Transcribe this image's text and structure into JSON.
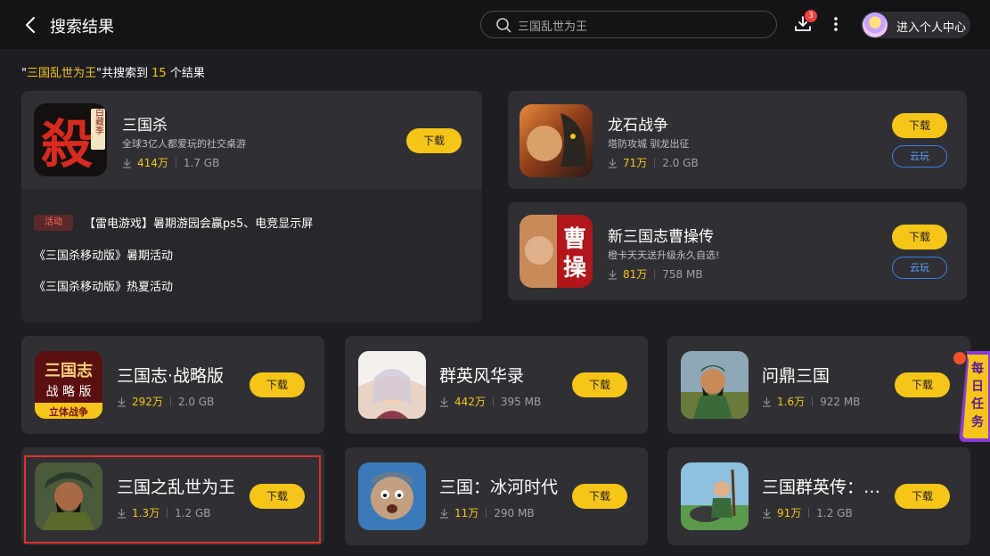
{
  "header": {
    "title": "搜索结果",
    "search_value": "三国乱世为王",
    "download_badge": "3",
    "user_center_label": "进入个人中心"
  },
  "summary": {
    "quote_open": "\"",
    "keyword": "三国乱世为王",
    "quote_close": "\"",
    "text_mid": "共搜索到",
    "count": "15",
    "text_end": "个结果"
  },
  "featured": {
    "name": "三国杀",
    "icon_text": "殺",
    "icon_badge": "白藏季",
    "desc": "全球3亿人都爱玩的社交桌游",
    "downloads": "414万",
    "size": "1.7 GB",
    "download_label": "下载",
    "events": [
      {
        "tag": "活动",
        "title": "【雷电游戏】暑期游园会赢ps5、电竞显示屏"
      },
      {
        "tag": "",
        "title": "《三国杀移动版》暑期活动"
      },
      {
        "tag": "",
        "title": "《三国杀移动版》热夏活动"
      }
    ]
  },
  "side_apps": [
    {
      "name": "龙石战争",
      "desc": "塔防攻城 驯龙出征",
      "downloads": "71万",
      "size": "2.0 GB",
      "download_label": "下载",
      "cloud_label": "云玩"
    },
    {
      "name": "新三国志曹操传",
      "desc": "橙卡天天送升级永久自选!",
      "downloads": "81万",
      "size": "758 MB",
      "download_label": "下载",
      "cloud_label": "云玩",
      "icon_text": "曹操"
    }
  ],
  "grid_apps": [
    {
      "name": "三国志·战略版",
      "downloads": "292万",
      "size": "2.0 GB",
      "download_label": "下载",
      "icon_text_top": "三国志",
      "icon_text_mid": "战略版",
      "icon_text_bottom": "立体战争"
    },
    {
      "name": "群英风华录",
      "downloads": "442万",
      "size": "395 MB",
      "download_label": "下载"
    },
    {
      "name": "问鼎三国",
      "downloads": "1.6万",
      "size": "922 MB",
      "download_label": "下载"
    },
    {
      "name": "三国之乱世为王",
      "downloads": "1.3万",
      "size": "1.2 GB",
      "download_label": "下载"
    },
    {
      "name": "三国：冰河时代",
      "downloads": "11万",
      "size": "290 MB",
      "download_label": "下载"
    },
    {
      "name": "三国群英传：…",
      "downloads": "91万",
      "size": "1.2 GB",
      "download_label": "下载"
    }
  ],
  "daily_task": {
    "label": "每日任务"
  },
  "colors": {
    "accent": "#f5c518",
    "cloud": "#3d7fe0",
    "highlight": "#e0302c",
    "background": "#1e1e22",
    "card": "#303034"
  }
}
